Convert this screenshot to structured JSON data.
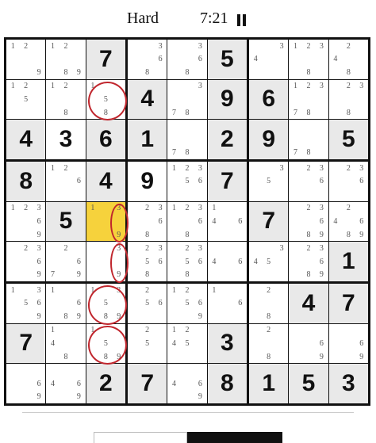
{
  "header": {
    "difficulty": "Hard",
    "timer": "7:21",
    "pause_icon": "pause-icon"
  },
  "colors": {
    "highlight": "#e9e9e9",
    "selected": "#f6d23c",
    "annotation": "#c0262d"
  },
  "selected_cell": [
    4,
    2
  ],
  "highlighted_cells": [
    [
      0,
      2
    ],
    [
      0,
      5
    ],
    [
      1,
      3
    ],
    [
      1,
      5
    ],
    [
      1,
      6
    ],
    [
      2,
      0
    ],
    [
      2,
      2
    ],
    [
      2,
      3
    ],
    [
      2,
      5
    ],
    [
      2,
      6
    ],
    [
      2,
      8
    ],
    [
      3,
      0
    ],
    [
      3,
      2
    ],
    [
      3,
      5
    ],
    [
      4,
      1
    ],
    [
      4,
      6
    ],
    [
      5,
      8
    ],
    [
      6,
      7
    ],
    [
      6,
      8
    ],
    [
      7,
      0
    ],
    [
      7,
      5
    ],
    [
      8,
      2
    ],
    [
      8,
      3
    ],
    [
      8,
      5
    ],
    [
      8,
      6
    ],
    [
      8,
      7
    ],
    [
      8,
      8
    ]
  ],
  "grid": [
    [
      {
        "c": [
          1,
          2,
          9
        ]
      },
      {
        "c": [
          1,
          2,
          8,
          9
        ]
      },
      {
        "v": "7"
      },
      {
        "c": [
          3,
          6,
          8
        ]
      },
      {
        "c": [
          3,
          6,
          8
        ]
      },
      {
        "v": "5"
      },
      {
        "c": [
          3,
          4
        ]
      },
      {
        "c": [
          1,
          2,
          3,
          8
        ]
      },
      {
        "c": [
          2,
          4,
          8
        ]
      }
    ],
    [
      {
        "c": [
          1,
          2,
          5
        ]
      },
      {
        "c": [
          1,
          2,
          8
        ]
      },
      {
        "c": [
          1,
          5,
          8
        ]
      },
      {
        "v": "4"
      },
      {
        "c": [
          3,
          7,
          8
        ]
      },
      {
        "v": "9"
      },
      {
        "v": "6"
      },
      {
        "c": [
          1,
          2,
          3,
          7,
          8
        ]
      },
      {
        "c": [
          2,
          3,
          8
        ]
      }
    ],
    [
      {
        "v": "4"
      },
      {
        "v": "3"
      },
      {
        "v": "6"
      },
      {
        "v": "1"
      },
      {
        "c": [
          7,
          8
        ]
      },
      {
        "v": "2"
      },
      {
        "v": "9"
      },
      {
        "c": [
          7,
          8
        ]
      },
      {
        "v": "5"
      }
    ],
    [
      {
        "v": "8"
      },
      {
        "c": [
          1,
          2,
          6
        ]
      },
      {
        "v": "4"
      },
      {
        "v": "9"
      },
      {
        "c": [
          1,
          2,
          3,
          5,
          6
        ]
      },
      {
        "v": "7"
      },
      {
        "c": [
          3,
          5
        ]
      },
      {
        "c": [
          2,
          3,
          6
        ]
      },
      {
        "c": [
          2,
          3,
          6
        ]
      }
    ],
    [
      {
        "c": [
          1,
          2,
          3,
          6,
          9
        ]
      },
      {
        "v": "5"
      },
      {
        "c": [
          1,
          3,
          9
        ]
      },
      {
        "c": [
          2,
          3,
          6,
          8
        ]
      },
      {
        "c": [
          1,
          2,
          3,
          6,
          8
        ]
      },
      {
        "c": [
          1,
          4,
          6
        ]
      },
      {
        "v": "7"
      },
      {
        "c": [
          2,
          3,
          6,
          8,
          9
        ]
      },
      {
        "c": [
          2,
          4,
          6,
          8,
          9
        ]
      }
    ],
    [
      {
        "c": [
          2,
          3,
          6,
          9
        ]
      },
      {
        "c": [
          2,
          6,
          7,
          9
        ]
      },
      {
        "c": [
          3,
          9
        ]
      },
      {
        "c": [
          2,
          3,
          5,
          6,
          8
        ]
      },
      {
        "c": [
          2,
          3,
          5,
          6,
          8
        ]
      },
      {
        "c": [
          4,
          6
        ]
      },
      {
        "c": [
          3,
          4,
          5
        ]
      },
      {
        "c": [
          2,
          3,
          6,
          8,
          9
        ]
      },
      {
        "v": "1"
      }
    ],
    [
      {
        "c": [
          1,
          3,
          5,
          6,
          9
        ]
      },
      {
        "c": [
          1,
          6,
          8,
          9
        ]
      },
      {
        "c": [
          1,
          3,
          5,
          8,
          9
        ]
      },
      {
        "c": [
          2,
          5,
          6
        ]
      },
      {
        "c": [
          1,
          2,
          5,
          6,
          9
        ]
      },
      {
        "c": [
          1,
          6
        ]
      },
      {
        "c": [
          2,
          8
        ]
      },
      {
        "v": "4"
      },
      {
        "v": "7"
      }
    ],
    [
      {
        "v": "7"
      },
      {
        "c": [
          1,
          4,
          8
        ]
      },
      {
        "c": [
          1,
          5,
          8,
          9
        ]
      },
      {
        "c": [
          2,
          5
        ]
      },
      {
        "c": [
          1,
          2,
          4,
          5
        ]
      },
      {
        "v": "3"
      },
      {
        "c": [
          2,
          8
        ]
      },
      {
        "c": [
          6,
          9
        ]
      },
      {
        "c": [
          6,
          9
        ]
      }
    ],
    [
      {
        "c": [
          6,
          9
        ]
      },
      {
        "c": [
          4,
          6,
          9
        ]
      },
      {
        "v": "2"
      },
      {
        "v": "7"
      },
      {
        "c": [
          4,
          6,
          9
        ]
      },
      {
        "v": "8"
      },
      {
        "v": "1"
      },
      {
        "v": "5"
      },
      {
        "v": "3"
      }
    ]
  ],
  "annotations": [
    {
      "row": 1,
      "col": 2
    },
    {
      "row": 4,
      "col": 2,
      "part": "right"
    },
    {
      "row": 5,
      "col": 2,
      "part": "right"
    },
    {
      "row": 6,
      "col": 2
    },
    {
      "row": 7,
      "col": 2
    }
  ]
}
